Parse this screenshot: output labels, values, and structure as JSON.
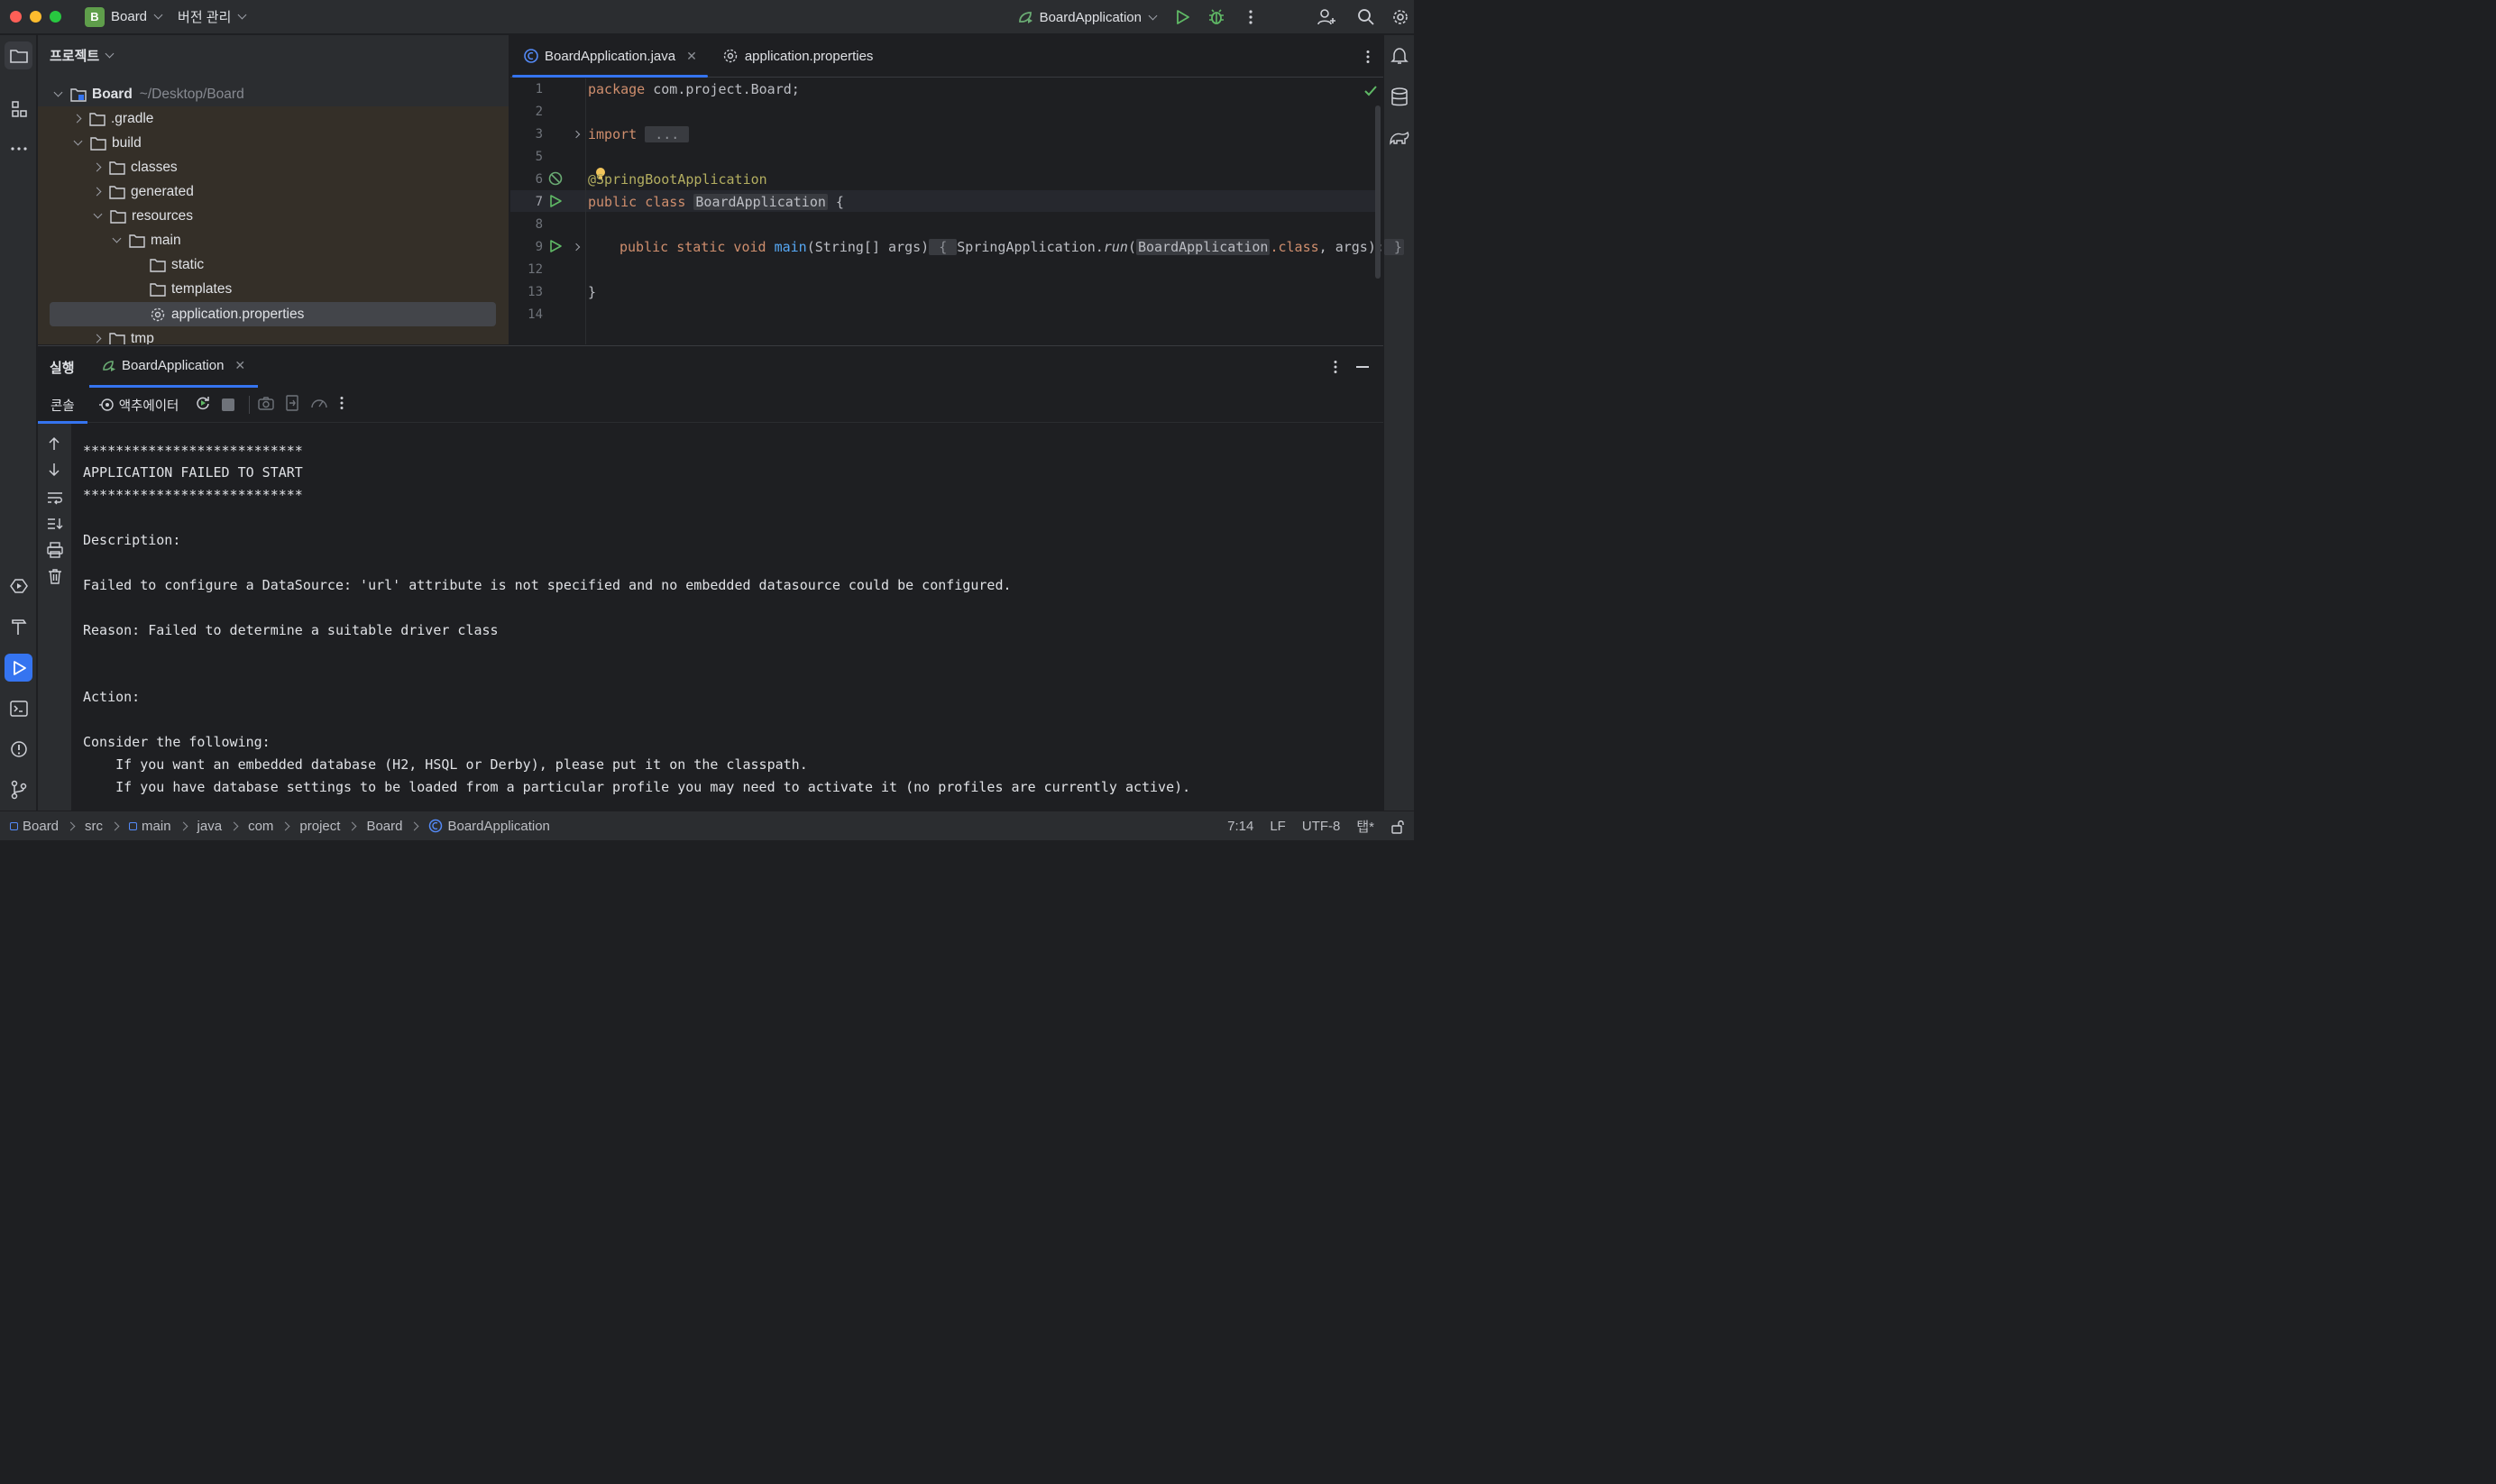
{
  "titlebar": {
    "project_badge": "B",
    "project_name": "Board",
    "vcs": "버전 관리",
    "run_config": "BoardApplication"
  },
  "project_panel": {
    "title": "프로젝트",
    "root_name": "Board",
    "root_path": "~/Desktop/Board",
    "items": [
      {
        "label": ".gradle"
      },
      {
        "label": "build"
      },
      {
        "label": "classes"
      },
      {
        "label": "generated"
      },
      {
        "label": "resources"
      },
      {
        "label": "main"
      },
      {
        "label": "static"
      },
      {
        "label": "templates"
      },
      {
        "label": "application.properties"
      },
      {
        "label": "tmp"
      }
    ]
  },
  "editor": {
    "tabs": [
      {
        "label": "BoardApplication.java"
      },
      {
        "label": "application.properties"
      }
    ],
    "line_numbers": [
      "1",
      "2",
      "3",
      "5",
      "6",
      "7",
      "8",
      "9",
      "12",
      "13",
      "14"
    ],
    "code": {
      "l1_kw": "package",
      "l1_rest": " com.project.Board;",
      "l3_kw": "import",
      "l3_fold": " ... ",
      "l6": "@SpringBootApplication",
      "l7_kw": "public class",
      "l7_cls": "BoardApplication",
      "l7_rest": " {",
      "l9_kw": "public static void",
      "l9_fn": "main",
      "l9_args": "(String[] args)",
      "l9_brace": " { ",
      "l9_call": "SpringApplication.",
      "l9_run": "run",
      "l9_p1": "(",
      "l9_cls": "BoardApplication",
      "l9_kw2": ".class",
      "l9_end": ", args);",
      "l9_close": " }",
      "l13": "}"
    }
  },
  "run_panel": {
    "title": "실행",
    "tab": "BoardApplication",
    "subtab_console": "콘솔",
    "subtab_actuator": "액추에이터",
    "console_lines": [
      "***************************",
      "APPLICATION FAILED TO START",
      "***************************",
      "Description:",
      "Failed to configure a DataSource: 'url' attribute is not specified and no embedded datasource could be configured.",
      "Reason: Failed to determine a suitable driver class",
      "Action:",
      "Consider the following:",
      "    If you want an embedded database (H2, HSQL or Derby), please put it on the classpath.",
      "    If you have database settings to be loaded from a particular profile you may need to activate it (no profiles are currently active)."
    ]
  },
  "statusbar": {
    "crumbs": [
      "Board",
      "src",
      "main",
      "java",
      "com",
      "project",
      "Board",
      "BoardApplication"
    ],
    "position": "7:14",
    "line_sep": "LF",
    "encoding": "UTF-8",
    "indent": "탭*"
  }
}
